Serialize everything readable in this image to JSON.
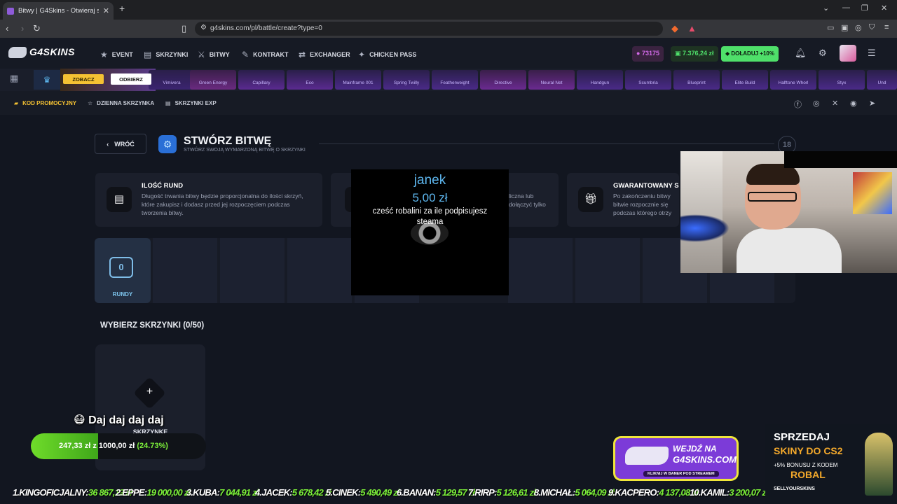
{
  "browser": {
    "tab_title": "Bitwy | G4Skins - Otwieraj skrzynk",
    "url": "g4skins.com/pl/battle/create?type=0"
  },
  "header": {
    "logo": "G4SKINS",
    "nav": [
      "EVENT",
      "SKRZYNKI",
      "BITWY",
      "KONTRAKT",
      "EXCHANGER",
      "CHICKEN PASS"
    ],
    "points": "73175",
    "balance": "7.376,24 zł",
    "deposit_label": "DOŁADUJ +10%"
  },
  "drops": {
    "zobacz": "ZOBACZ",
    "odbierz": "ODBIERZ",
    "items": [
      "Vimivera",
      "Green Energy",
      "Capillary",
      "Eco",
      "Mainframe 001",
      "Spring Twilly",
      "Featherweight",
      "Directive",
      "Neural Net",
      "Handgun",
      "Scumbria",
      "Blueprint",
      "Elite Build",
      "Halftone Whorl",
      "Styx",
      "Und"
    ]
  },
  "subnav": {
    "promo": "KOD PROMOCYJNY",
    "daily": "DZIENNA SKRZYNKA",
    "exp": "SKRZYNKI EXP"
  },
  "page": {
    "back": "WRÓĆ",
    "title": "STWÓRZ BITWĘ",
    "subtitle": "STWÓRZ SWOJĄ WYMARZONĄ BITWĘ O SKRZYNKI",
    "level": "18"
  },
  "cards": [
    {
      "title": "ILOŚĆ RUND",
      "desc": "Długość trwania bitwy będzie proporcjonalna do ilości skrzyń, które zakupisz i dodasz przed jej rozpoczęciem podczas tworzenia bitwy."
    },
    {
      "title": "",
      "desc": "liczna lub\ndołączyć tylko"
    },
    {
      "title": "GWARANTOWANY S",
      "desc": "Po zakończeniu bitwy\nbitwie rozpocznie się\npodczas którego otrzy"
    }
  ],
  "rounds": {
    "count": "0",
    "label": "RUNDY"
  },
  "boxes": {
    "title": "WYBIERZ SKRZYNKI (0/50)",
    "add_label": "SKRZYNKĘ"
  },
  "donation": {
    "name": "janek",
    "amount": "5,00 zł",
    "message": "cześć robalini za ile podpisujesz steama"
  },
  "goal": {
    "text": "Daj daj daj daj",
    "current": "247,33 zł",
    "joiner": "z",
    "target": "1000,00 zł",
    "percent": "(24.73%)",
    "fraction": 0.2473
  },
  "banner_g4": {
    "line1": "WEJDŹ NA",
    "line2": "G4SKINS.COM",
    "line3": "KLIKNIJ W BANER POD STREAMEM"
  },
  "banner_sell": {
    "line1": "SPRZEDAJ",
    "line2": "SKINY DO CS2",
    "line3": "+5% BONUSU Z KODEM",
    "code": "ROBAL",
    "brand": "SELLYOURSKINS"
  },
  "ticker": [
    {
      "name": "1.KINGOFICJALNY:",
      "value": "36 867,19 zł"
    },
    {
      "name": "2.EPPE:",
      "value": "19 000,00 zł"
    },
    {
      "name": "3.KUBA:",
      "value": "7 044,91 zł"
    },
    {
      "name": "4.JACEK:",
      "value": "5 678,42 zł"
    },
    {
      "name": "5.CINEK:",
      "value": "5 490,49 zł"
    },
    {
      "name": "6.BANAN:",
      "value": "5 129,57 zł"
    },
    {
      "name": "7.RIRP:",
      "value": "5 126,61 zł"
    },
    {
      "name": "8.MICHAŁ:",
      "value": "5 064,09 zł"
    },
    {
      "name": "9.KACPERO:",
      "value": "4 137,08 zł"
    },
    {
      "name": "10.KAMIL:",
      "value": "3 200,07 zł"
    }
  ],
  "colors": {
    "accent_green": "#4fe06a",
    "points_purple": "#d36be9",
    "donation_blue": "#5db6ee"
  }
}
